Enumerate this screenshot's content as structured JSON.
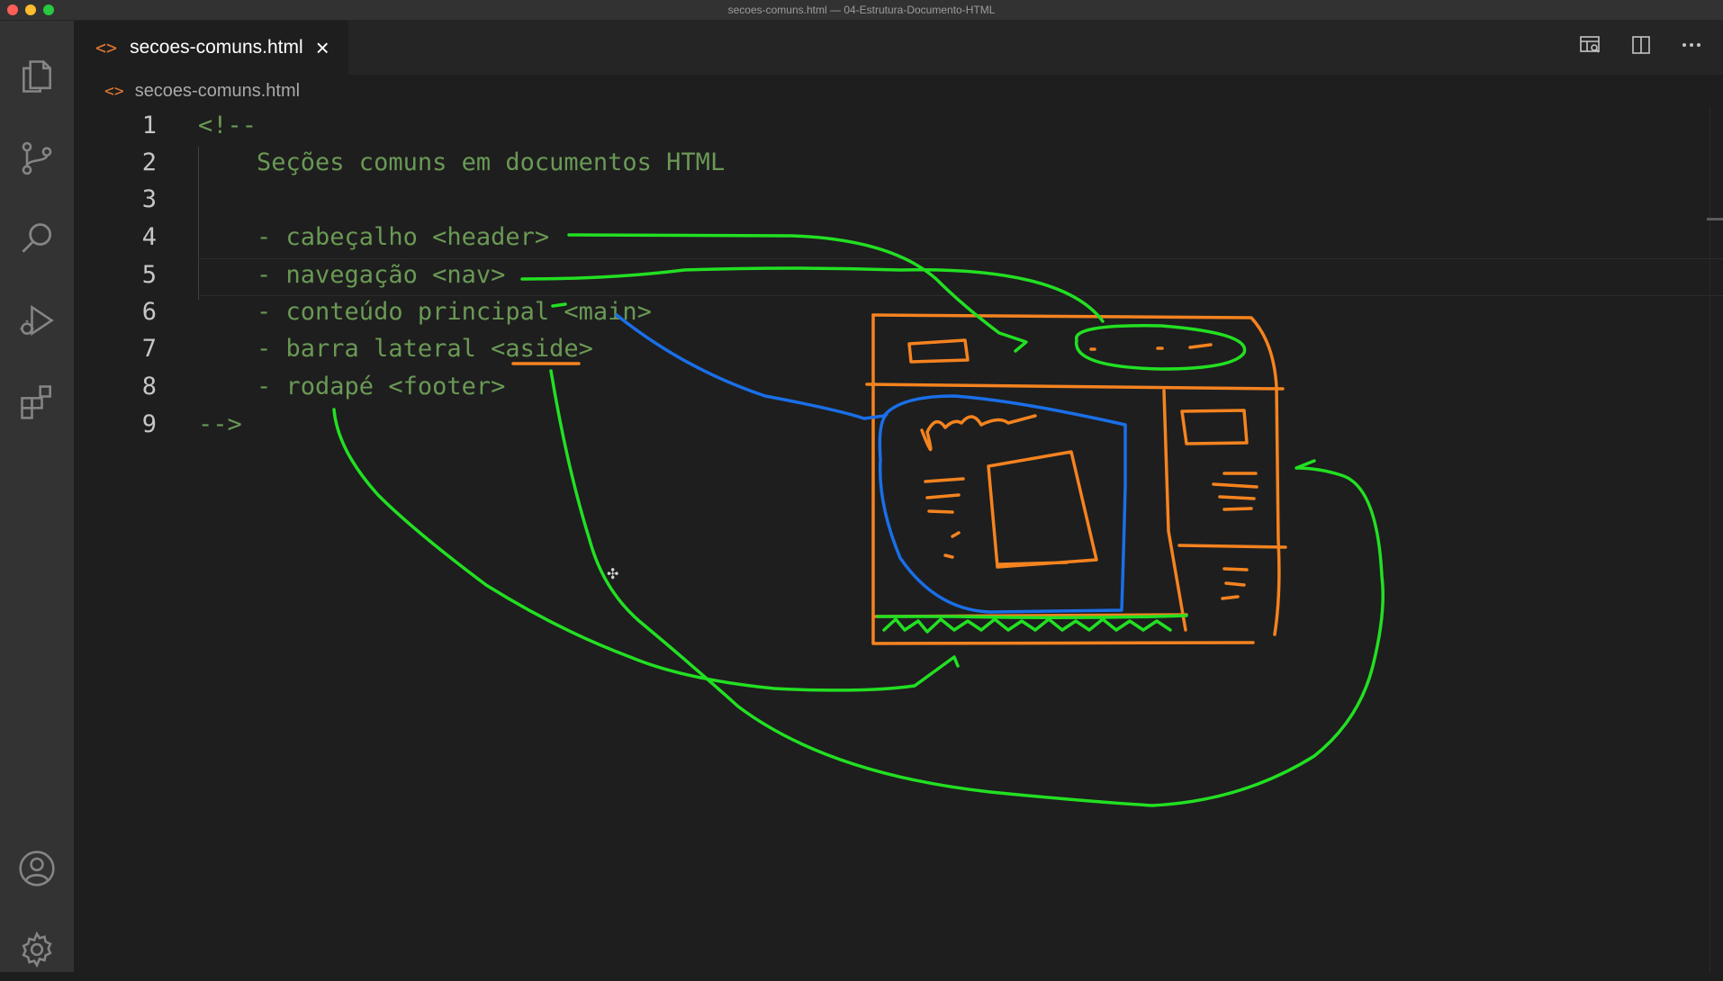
{
  "window": {
    "title": "secoes-comuns.html — 04-Estrutura-Documento-HTML"
  },
  "activity_bar": {
    "items": [
      "files-icon",
      "source-control-icon",
      "search-icon",
      "run-debug-icon",
      "extensions-icon"
    ],
    "bottom_items": [
      "account-icon",
      "settings-gear-icon"
    ]
  },
  "tabs": [
    {
      "icon": "<>",
      "label": "secoes-comuns.html",
      "close": "×",
      "active": true
    }
  ],
  "editor_actions": [
    "open-preview-icon",
    "split-editor-icon",
    "more-actions-icon"
  ],
  "breadcrumb": {
    "icon": "<>",
    "label": "secoes-comuns.html"
  },
  "editor": {
    "lines": [
      {
        "num": "1",
        "text": "<!--"
      },
      {
        "num": "2",
        "text": "    Seções comuns em documentos HTML"
      },
      {
        "num": "3",
        "text": ""
      },
      {
        "num": "4",
        "text": "    - cabeçalho <header>"
      },
      {
        "num": "5",
        "text": "    - navegação <nav>"
      },
      {
        "num": "6",
        "text": "    - conteúdo principal <main>"
      },
      {
        "num": "7",
        "text": "    - barra lateral <aside>"
      },
      {
        "num": "8",
        "text": "    - rodapé <footer>"
      },
      {
        "num": "9",
        "text": "-->"
      }
    ],
    "colors": {
      "comment": "#6a9955",
      "line_number": "#c6c6c6",
      "background": "#1e1e1e"
    }
  },
  "annotation_colors": {
    "green": "#22e022",
    "orange": "#f5831f",
    "blue": "#1a6fe8"
  }
}
